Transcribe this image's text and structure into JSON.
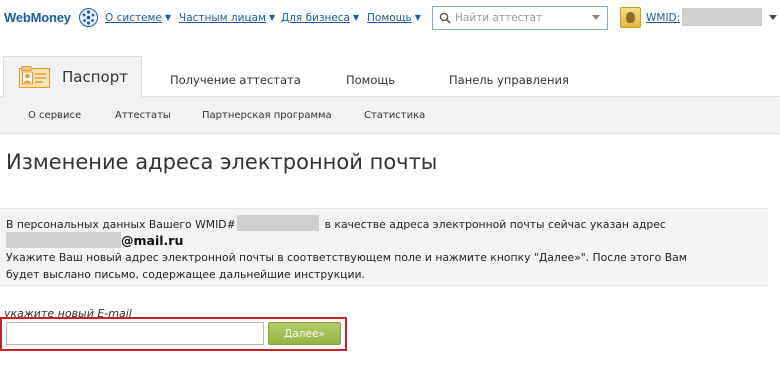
{
  "header": {
    "logo_text": "WebMoney",
    "nav": [
      {
        "label": "О системе"
      },
      {
        "label": "Частным лицам"
      },
      {
        "label": "Для бизнеса"
      },
      {
        "label": "Помощь"
      }
    ],
    "search": {
      "placeholder": "Найти аттестат",
      "value": ""
    },
    "wmid_label": "WMID:"
  },
  "tabs": {
    "active": "Паспорт",
    "items": [
      {
        "label": "Получение аттестата"
      },
      {
        "label": "Помощь"
      },
      {
        "label": "Панель управления"
      }
    ]
  },
  "subnav": [
    {
      "label": "О сервисе"
    },
    {
      "label": "Аттестаты"
    },
    {
      "label": "Партнерская программа"
    },
    {
      "label": "Статистика"
    }
  ],
  "main": {
    "title": "Изменение адреса электронной почты",
    "info": {
      "line1_before": "В персональных данных Вашего WMID#",
      "line1_after": "в качестве адреса электронной почты сейчас указан адрес",
      "email_domain": "@mail.ru",
      "line3": "Укажите Ваш новый адрес электронной почты в соответствующем поле и нажмите кнопку \"Далее»\". После этого Вам",
      "line4": "будет выслано письмо, содержащее дальнейшие инструкции."
    },
    "form": {
      "label": "укажите новый E-mail",
      "email_value": "",
      "email_placeholder": "",
      "submit_label": "Далее»"
    }
  },
  "colors": {
    "link": "#1b5da8",
    "button": "#a3be55",
    "highlight": "#cc1f1f",
    "panel": "#f2f2f2"
  },
  "icons": [
    "webmoney-globe-icon",
    "chevron-down-icon",
    "search-icon",
    "avatar",
    "passport-icon"
  ]
}
